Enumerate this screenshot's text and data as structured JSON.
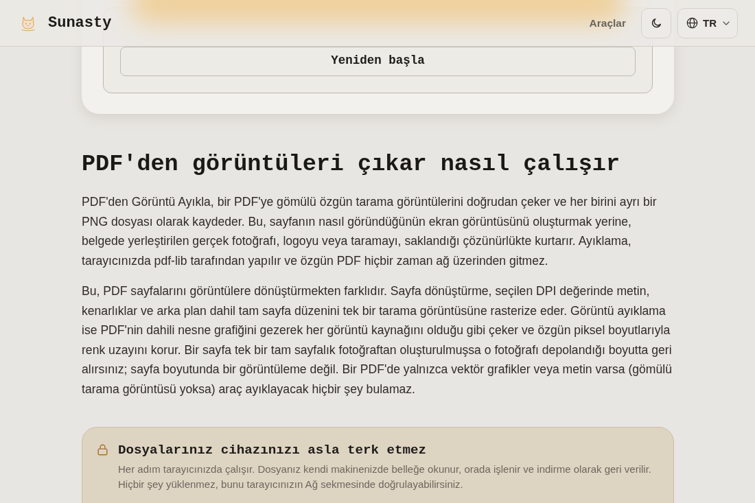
{
  "header": {
    "brand": "Sunasty",
    "nav_link": "Araçlar",
    "language": "TR"
  },
  "tool_card": {
    "restart_button": "Yeniden başla"
  },
  "article": {
    "heading": "PDF'den görüntüleri çıkar nasıl çalışır",
    "paragraphs": [
      "PDF'den Görüntü Ayıkla, bir PDF'ye gömülü özgün tarama görüntülerini doğrudan çeker ve her birini ayrı bir PNG dosyası olarak kaydeder. Bu, sayfanın nasıl göründüğünün ekran görüntüsünü oluşturmak yerine, belgede yerleştirilen gerçek fotoğrafı, logoyu veya taramayı, saklandığı çözünürlükte kurtarır. Ayıklama, tarayıcınızda pdf-lib tarafından yapılır ve özgün PDF hiçbir zaman ağ üzerinden gitmez.",
      "Bu, PDF sayfalarını görüntülere dönüştürmekten farklıdır. Sayfa dönüştürme, seçilen DPI değerinde metin, kenarlıklar ve arka plan dahil tam sayfa düzenini tek bir tarama görüntüsüne rasterize eder. Görüntü ayıklama ise PDF'nin dahili nesne grafiğini gezerek her görüntü kaynağını olduğu gibi çeker ve özgün piksel boyutlarıyla renk uzayını korur. Bir sayfa tek bir tam sayfalık fotoğraftan oluşturulmuşsa o fotoğrafı depolandığı boyutta geri alırsınız; sayfa boyutunda bir görüntüleme değil. Bir PDF'de yalnızca vektör grafikler veya metin varsa (gömülü tarama görüntüsü yoksa) araç ayıklayacak hiçbir şey bulamaz."
    ]
  },
  "privacy_note": {
    "title": "Dosyalarınız cihazınızı asla terk etmez",
    "text": "Her adım tarayıcınızda çalışır. Dosyanız kendi makinenizde belleğe okunur, orada işlenir ve indirme olarak geri verilir. Hiçbir şey yüklenmez, bunu tarayıcınızın Ağ sekmesinde doğrulayabilirsiniz."
  }
}
